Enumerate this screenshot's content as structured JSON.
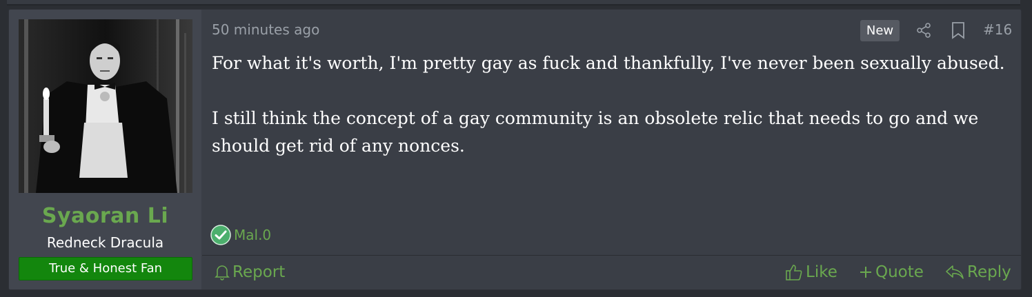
{
  "post": {
    "timestamp": "50 minutes ago",
    "new_badge": "New",
    "post_number": "#16",
    "body_paragraphs": [
      "For what it's worth, I'm pretty gay as fuck and thankfully, I've never been sexually abused.",
      "I still think the concept of a gay community is an obsolete relic that needs to go and we should get rid of any nonces."
    ],
    "reaction_user": "Mal.0"
  },
  "user": {
    "name": "Syaoran Li",
    "title": "Redneck Dracula",
    "banner": "True & Honest Fan"
  },
  "actions": {
    "report": "Report",
    "like": "Like",
    "quote": "Quote",
    "reply": "Reply"
  },
  "colors": {
    "accent_green": "#6aa84f",
    "banner_green": "#13860d",
    "background": "#3a3e46"
  },
  "icons": [
    "share-icon",
    "bookmark-icon",
    "check-reaction-icon",
    "bell-icon",
    "thumbs-up-icon",
    "plus-icon",
    "reply-arrow-icon"
  ]
}
